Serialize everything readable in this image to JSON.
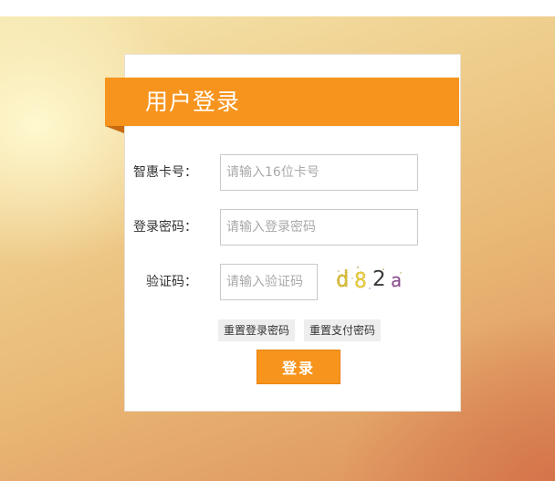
{
  "colors": {
    "accent": "#f7941d",
    "card": "#ffffff"
  },
  "header": {
    "title": "用户登录"
  },
  "form": {
    "card_number": {
      "label": "智惠卡号：",
      "placeholder": "请输入16位卡号",
      "value": ""
    },
    "password": {
      "label": "登录密码：",
      "placeholder": "请输入登录密码",
      "value": ""
    },
    "captcha": {
      "label": "验证码：",
      "placeholder": "请输入验证码",
      "value": "",
      "image_text": "d82a"
    }
  },
  "actions": {
    "reset_login_password": "重置登录密码",
    "reset_pay_password": "重置支付密码",
    "login": "登录"
  }
}
